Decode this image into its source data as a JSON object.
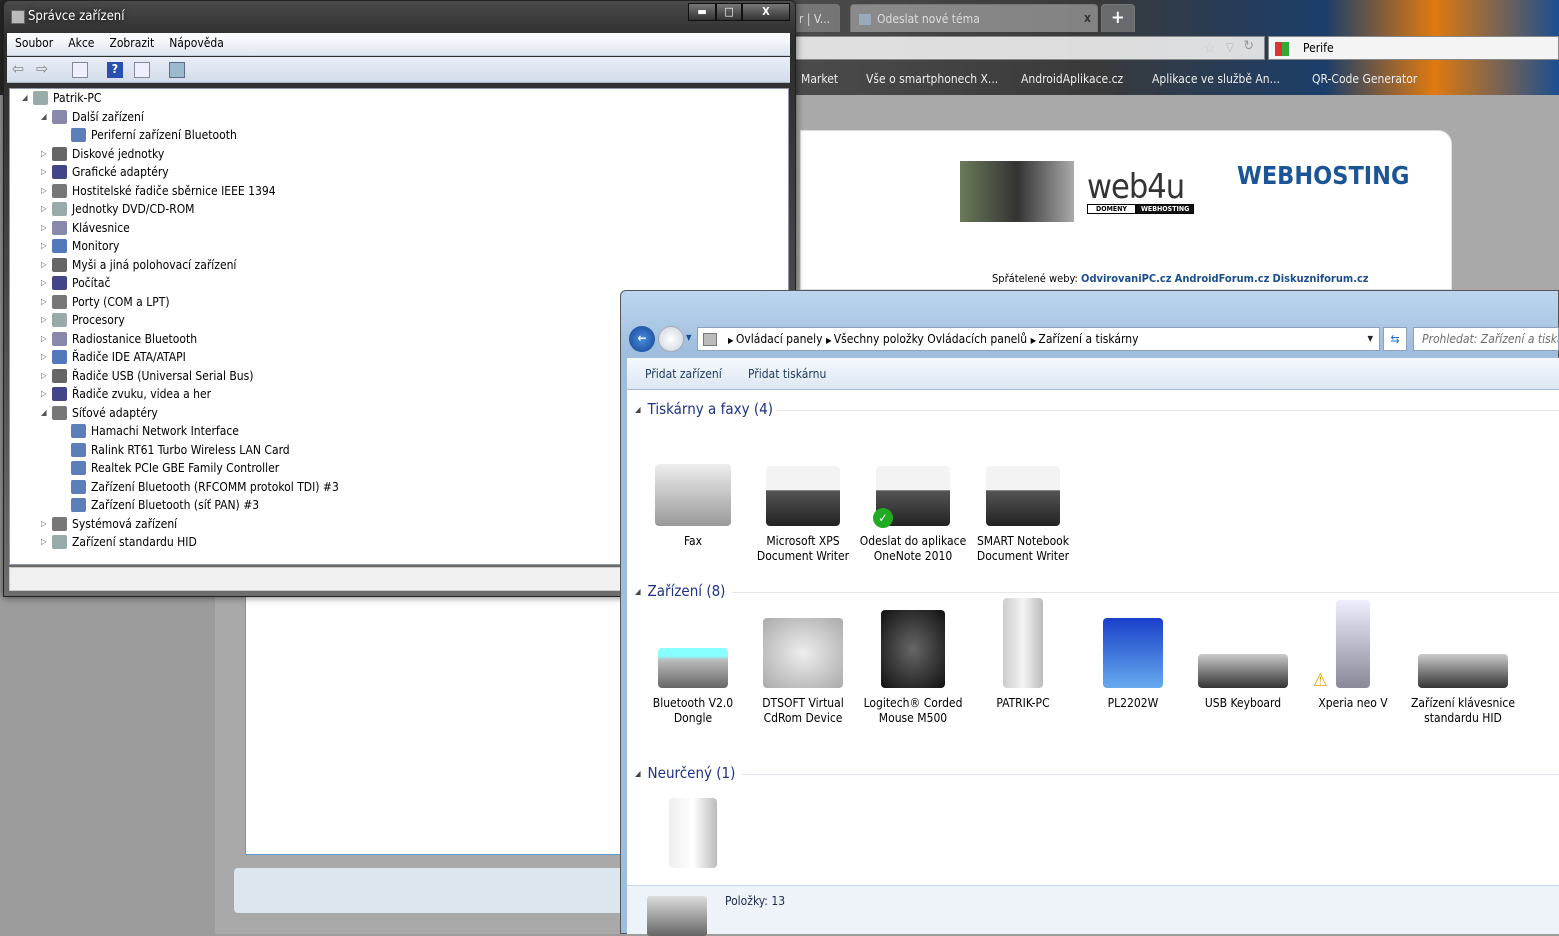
{
  "browser": {
    "tabs": [
      {
        "label": "r | V..."
      },
      {
        "label": "Odeslat nové téma"
      }
    ],
    "new_tab": "+",
    "search_value": "Perife",
    "bookmarks": [
      "Market",
      "Vše o smartphonech X...",
      "AndroidAplikace.cz",
      "Aplikace ve službě An...",
      "QR-Code Generator"
    ],
    "page": {
      "banner_title": "WEBHOSTING",
      "logo": "web4u",
      "logo_sub": [
        "DOMÉNY",
        "WEBHOSTING"
      ],
      "friends_label": "Spřátelené weby:",
      "friends": [
        "OdvirovaniPC.cz",
        "AndroidForum.cz",
        "Diskuzniforum.cz"
      ]
    }
  },
  "device_manager": {
    "title": "Správce zařízení",
    "controls": {
      "minimize": "▬",
      "maximize": "□",
      "close": "X"
    },
    "menu": [
      "Soubor",
      "Akce",
      "Zobrazit",
      "Nápověda"
    ],
    "tree": [
      {
        "label": "Patrik-PC",
        "level": 0,
        "state": "open"
      },
      {
        "label": "Další zařízení",
        "level": 1,
        "state": "open"
      },
      {
        "label": "Periferní zařízení Bluetooth",
        "level": 2,
        "state": "leaf"
      },
      {
        "label": "Diskové jednotky",
        "level": 1,
        "state": "closed"
      },
      {
        "label": "Grafické adaptéry",
        "level": 1,
        "state": "closed"
      },
      {
        "label": "Hostitelské řadiče sběrnice IEEE 1394",
        "level": 1,
        "state": "closed"
      },
      {
        "label": "Jednotky DVD/CD-ROM",
        "level": 1,
        "state": "closed"
      },
      {
        "label": "Klávesnice",
        "level": 1,
        "state": "closed"
      },
      {
        "label": "Monitory",
        "level": 1,
        "state": "closed"
      },
      {
        "label": "Myši a jiná polohovací zařízení",
        "level": 1,
        "state": "closed"
      },
      {
        "label": "Počítač",
        "level": 1,
        "state": "closed"
      },
      {
        "label": "Porty (COM a LPT)",
        "level": 1,
        "state": "closed"
      },
      {
        "label": "Procesory",
        "level": 1,
        "state": "closed"
      },
      {
        "label": "Radiostanice Bluetooth",
        "level": 1,
        "state": "closed"
      },
      {
        "label": "Řadiče IDE ATA/ATAPI",
        "level": 1,
        "state": "closed"
      },
      {
        "label": "Řadiče USB (Universal Serial Bus)",
        "level": 1,
        "state": "closed"
      },
      {
        "label": "Řadiče zvuku, videa a her",
        "level": 1,
        "state": "closed"
      },
      {
        "label": "Síťové adaptéry",
        "level": 1,
        "state": "open"
      },
      {
        "label": "Hamachi Network Interface",
        "level": 2,
        "state": "leaf"
      },
      {
        "label": "Ralink RT61 Turbo Wireless LAN Card",
        "level": 2,
        "state": "leaf"
      },
      {
        "label": "Realtek PCIe GBE Family Controller",
        "level": 2,
        "state": "leaf"
      },
      {
        "label": "Zařízení Bluetooth (RFCOMM protokol TDI) #3",
        "level": 2,
        "state": "leaf"
      },
      {
        "label": "Zařízení Bluetooth (síť PAN) #3",
        "level": 2,
        "state": "leaf"
      },
      {
        "label": "Systémová zařízení",
        "level": 1,
        "state": "closed"
      },
      {
        "label": "Zařízení standardu HID",
        "level": 1,
        "state": "closed"
      }
    ]
  },
  "devices_window": {
    "breadcrumb": [
      "Ovládací panely",
      "Všechny položky Ovládacích panelů",
      "Zařízení a tiskárny"
    ],
    "search_placeholder": "Prohledat: Zařízení a tiskárny",
    "commands": [
      "Přidat zařízení",
      "Přidat tiskárnu"
    ],
    "groups": [
      {
        "title": "Tiskárny a faxy (4)",
        "items": [
          {
            "label": "Fax",
            "icon": "fax"
          },
          {
            "label": "Microsoft XPS Document Writer",
            "icon": "printer"
          },
          {
            "label": "Odeslat do aplikace OneNote 2010",
            "icon": "printer-default"
          },
          {
            "label": "SMART Notebook Document Writer",
            "icon": "printer"
          }
        ]
      },
      {
        "title": "Zařízení (8)",
        "items": [
          {
            "label": "Bluetooth V2.0 Dongle",
            "icon": "usb"
          },
          {
            "label": "DTSOFT Virtual CdRom Device",
            "icon": "cdrom"
          },
          {
            "label": "Logitech® Corded Mouse M500",
            "icon": "mouse"
          },
          {
            "label": "PATRIK-PC",
            "icon": "computer"
          },
          {
            "label": "PL2202W",
            "icon": "monitor"
          },
          {
            "label": "USB Keyboard",
            "icon": "keyboard"
          },
          {
            "label": "Xperia neo V",
            "icon": "phone-warning"
          },
          {
            "label": "Zařízení klávesnice standardu HID",
            "icon": "keyboard"
          }
        ]
      },
      {
        "title": "Neurčený (1)",
        "items": [
          {
            "label": "",
            "icon": "tower"
          }
        ]
      }
    ],
    "status": "Položky: 13"
  }
}
